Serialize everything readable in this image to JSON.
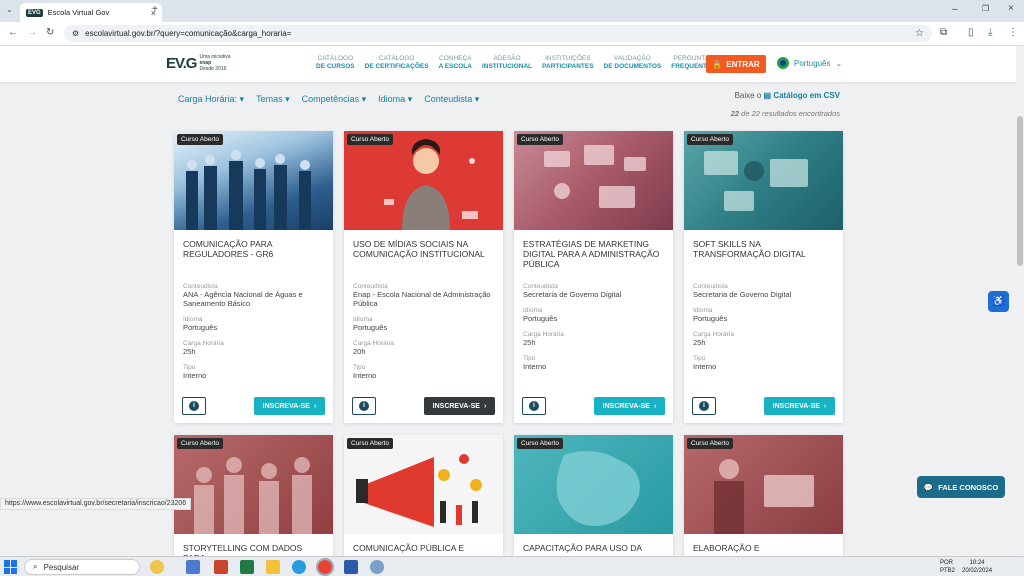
{
  "browser": {
    "tab_title": "Escola Virtual Gov",
    "favicon_text": "EVG",
    "url": "escolavirtual.gov.br/?query=comunicação&carga_horaria="
  },
  "header": {
    "logo_main": "EV.G",
    "logo_sub1": "Uma iniciativa",
    "logo_sub2": "enap",
    "logo_sub3": "Desde 2016",
    "nav": [
      {
        "l1": "CATÁLOGO",
        "l2": "DE CURSOS"
      },
      {
        "l1": "CATÁLOGO",
        "l2": "DE CERTIFICAÇÕES"
      },
      {
        "l1": "CONHEÇA",
        "l2": "A ESCOLA"
      },
      {
        "l1": "ADESÃO",
        "l2": "INSTITUCIONAL"
      },
      {
        "l1": "INSTITUIÇÕES",
        "l2": "PARTICIPANTES"
      },
      {
        "l1": "VALIDAÇÃO",
        "l2": "DE DOCUMENTOS"
      },
      {
        "l1": "PERGUNTAS",
        "l2": "FREQUENTES"
      }
    ],
    "login": "ENTRAR",
    "language": "Português"
  },
  "filters": [
    "Carga Horária:",
    "Temas",
    "Competências",
    "Idioma",
    "Conteudista"
  ],
  "csv": {
    "prefix": "Baixe o",
    "link": "Catálogo em CSV"
  },
  "results": {
    "bold": "22",
    "text": "de 22 resultados encontrados"
  },
  "labels": {
    "conteudista": "Conteudista",
    "idioma": "Idioma",
    "carga": "Carga Horária",
    "tipo": "Tipo",
    "inscreva": "INSCREVA-SE",
    "badge": "Curso Aberto"
  },
  "cards": [
    {
      "title": "COMUNICAÇÃO PARA REGULADORES - GR6",
      "conteudista": "ANA - Agência Nacional de Águas e Saneamento Básico",
      "idioma": "Português",
      "carga": "25h",
      "tipo": "Interno"
    },
    {
      "title": "USO DE MÍDIAS SOCIAIS NA COMUNICAÇÃO INSTITUCIONAL",
      "conteudista": "Enap - Escola Nacional de Administração Pública",
      "idioma": "Português",
      "carga": "20h",
      "tipo": "Interno"
    },
    {
      "title": "ESTRATÉGIAS DE MARKETING DIGITAL PARA A ADMINISTRAÇÃO PÚBLICA",
      "conteudista": "Secretaria de Governo Digital",
      "idioma": "Português",
      "carga": "25h",
      "tipo": "Interno"
    },
    {
      "title": "SOFT SKILLS NA TRANSFORMAÇÃO DIGITAL",
      "conteudista": "Secretaria de Governo Digital",
      "idioma": "Português",
      "carga": "25h",
      "tipo": "Interno"
    },
    {
      "title": "STORYTELLING COM DADOS PARA"
    },
    {
      "title": "COMUNICAÇÃO PÚBLICA E"
    },
    {
      "title": "CAPACITAÇÃO PARA USO DA"
    },
    {
      "title": "ELABORAÇÃO E"
    }
  ],
  "chat": "FALE CONOSCO",
  "status_url": "https://www.escolavirtual.gov.br/secretaria/inscricao/23206",
  "taskbar": {
    "search": "Pesquisar",
    "lang1": "POR",
    "lang2": "PTB2",
    "time": "10:24",
    "date": "20/02/2024"
  },
  "colors": {
    "accent": "#17b3c4",
    "login": "#f35a1f",
    "nav": "#1a8fa5"
  }
}
